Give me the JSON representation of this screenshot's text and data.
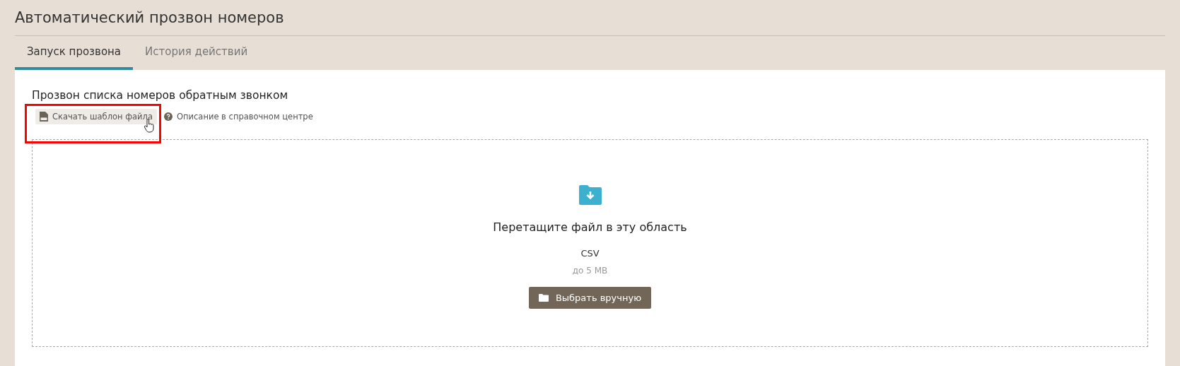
{
  "page": {
    "title": "Автоматический прозвон номеров"
  },
  "tabs": [
    {
      "label": "Запуск прозвона",
      "selected": true
    },
    {
      "label": "История действий",
      "selected": false
    }
  ],
  "section": {
    "title": "Прозвон списка номеров обратным звонком",
    "download_button": "Скачать шаблон файла",
    "help_link": "Описание в справочном центре"
  },
  "dropzone": {
    "title": "Перетащите файл в эту область",
    "format": "CSV",
    "limit": "до 5 MB",
    "button": "Выбрать вручную"
  }
}
